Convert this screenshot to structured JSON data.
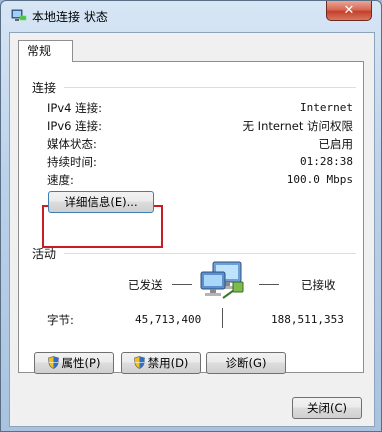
{
  "window": {
    "title": "本地连接 状态",
    "close_label": "✕"
  },
  "tabs": [
    {
      "label": "常规"
    }
  ],
  "connection": {
    "section_title": "连接",
    "rows": [
      {
        "label": "IPv4 连接:",
        "value": "Internet"
      },
      {
        "label": "IPv6 连接:",
        "value": "无 Internet 访问权限"
      },
      {
        "label": "媒体状态:",
        "value": "已启用"
      },
      {
        "label": "持续时间:",
        "value": "01:28:38"
      },
      {
        "label": "速度:",
        "value": "100.0 Mbps"
      }
    ],
    "details_button": "详细信息(E)..."
  },
  "activity": {
    "section_title": "活动",
    "sent_label": "已发送",
    "received_label": "已接收",
    "bytes_label": "字节:",
    "bytes_sent": "45,713,400",
    "bytes_received": "188,511,353"
  },
  "buttons": {
    "properties": "属性(P)",
    "disable": "禁用(D)",
    "diagnose": "诊断(G)",
    "close": "关闭(C)"
  },
  "icons": {
    "title": "network-connection-icon",
    "activity": "network-computers-icon",
    "shield": "uac-shield-icon"
  },
  "colors": {
    "highlight_box": "#cc1b22",
    "close_button": "#c2412c"
  }
}
